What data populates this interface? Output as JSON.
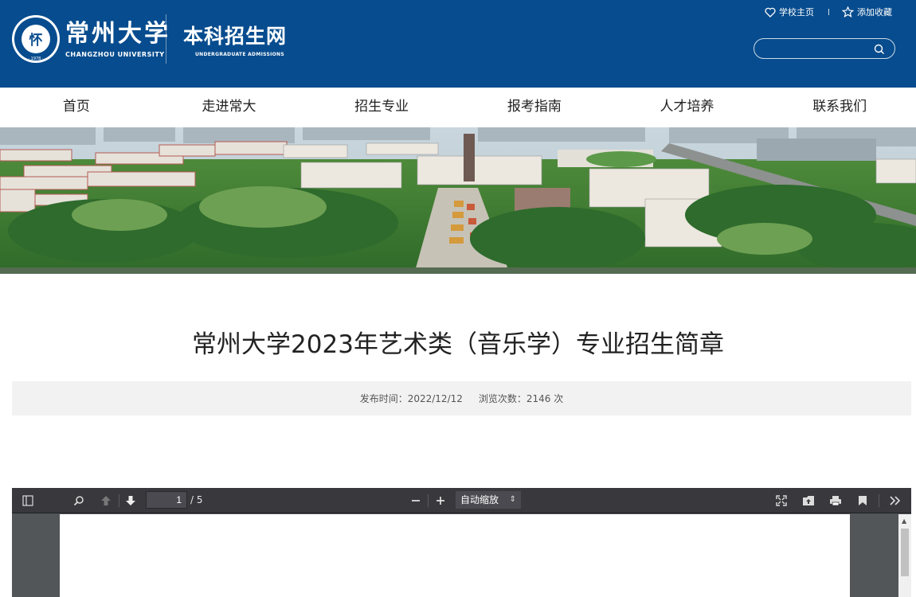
{
  "header": {
    "logo_cn": "常州大学",
    "logo_en": "CHANGZHOU UNIVERSITY",
    "site_name": "本科招生网",
    "site_subtitle": "UNDERGRADUATE ADMISSIONS",
    "links": {
      "home": "学校主页",
      "favorite": "添加收藏"
    },
    "search_placeholder": ""
  },
  "nav": {
    "items": [
      "首页",
      "走进常大",
      "招生专业",
      "报考指南",
      "人才培养",
      "联系我们"
    ]
  },
  "article": {
    "title": "常州大学2023年艺术类（音乐学）专业招生简章",
    "publish_label": "发布时间：",
    "publish_date": "2022/12/12",
    "views_label": "浏览次数：",
    "views_count": "2146",
    "views_unit": "次"
  },
  "pdf_viewer": {
    "current_page": "1",
    "total_pages": "/ 5",
    "zoom": "自动缩放"
  },
  "colors": {
    "header_bg": "#074c8e",
    "toolbar_bg": "#38383d",
    "meta_bg": "#f2f2f2"
  }
}
